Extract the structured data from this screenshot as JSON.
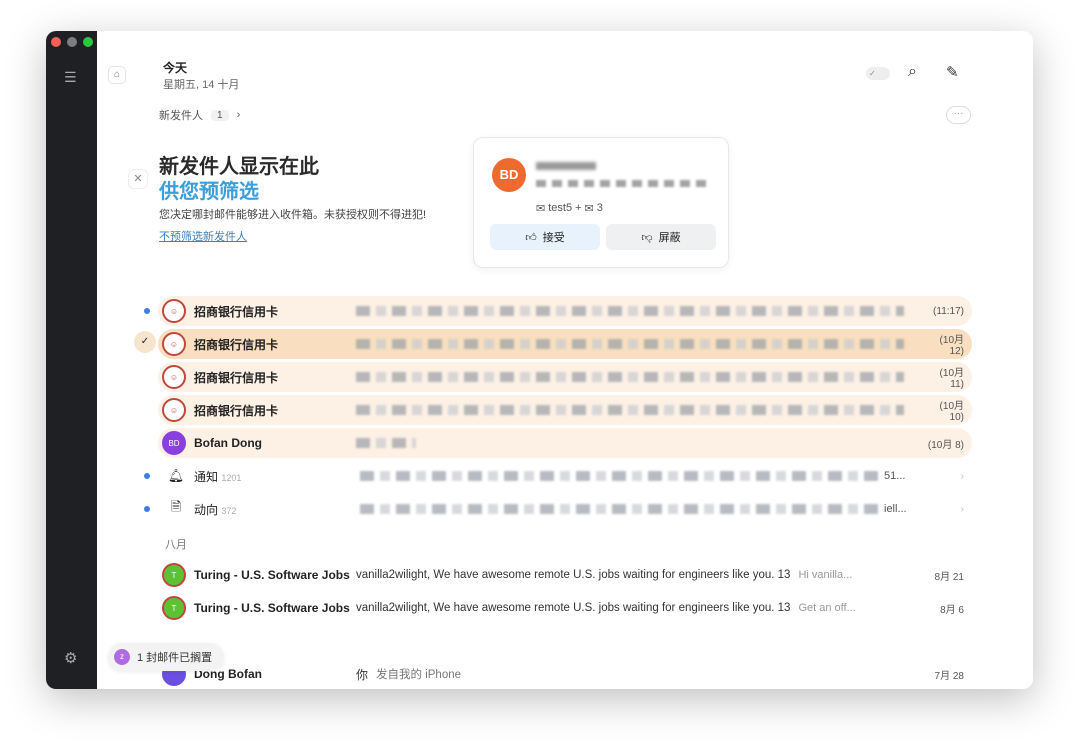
{
  "header": {
    "title": "今天",
    "date": "星期五, 14 十月"
  },
  "new_senders": {
    "label": "新发件人",
    "count": "1",
    "chevron": "›"
  },
  "promo": {
    "title": "新发件人显示在此",
    "subtitle": "供您预筛选",
    "desc": "您决定哪封邮件能够进入收件箱。未获授权则不得进犯!",
    "link": "不预筛选新发件人"
  },
  "card": {
    "initials": "BD",
    "meta": "test5 + ",
    "meta_count": "3",
    "accept": "接受",
    "block": "屏蔽"
  },
  "rows": [
    {
      "sender": "招商银行信用卡",
      "date": "(11:17)",
      "unread": true
    },
    {
      "sender": "招商银行信用卡",
      "date": "(10月 12)",
      "selected": true
    },
    {
      "sender": "招商银行信用卡",
      "date": "(10月 11)"
    },
    {
      "sender": "招商银行信用卡",
      "date": "(10月 10)"
    },
    {
      "sender": "Bofan Dong",
      "initials": "BD",
      "date": "(10月 8)"
    }
  ],
  "groups": [
    {
      "name": "通知",
      "count": "1201",
      "tail": "51...",
      "icon": "bell-icon"
    },
    {
      "name": "动向",
      "count": "372",
      "tail": "iell...",
      "icon": "document-icon"
    }
  ],
  "section_august": "八月",
  "august": [
    {
      "sender": "Turing - U.S. Software Jobs",
      "subject": "vanilla2wilight, We have awesome remote U.S. jobs waiting for engineers like you. 13",
      "preview": "Hi vanilla...",
      "date": "8月 21"
    },
    {
      "sender": "Turing - U.S. Software Jobs",
      "subject": "vanilla2wilight, We have awesome remote U.S. jobs waiting for engineers like you. 13",
      "preview": "Get an off...",
      "date": "8月 6"
    }
  ],
  "last": {
    "sender": "Dong Bofan",
    "you": "你",
    "preview": "发自我的 iPhone",
    "date": "7月 28"
  },
  "toast": {
    "text": "1 封邮件已搁置"
  },
  "colors": {
    "accent": "#3d9fd9",
    "highlight": "#fdf0e4",
    "selected": "#f9dfbf",
    "sidebar": "#1f2023"
  }
}
